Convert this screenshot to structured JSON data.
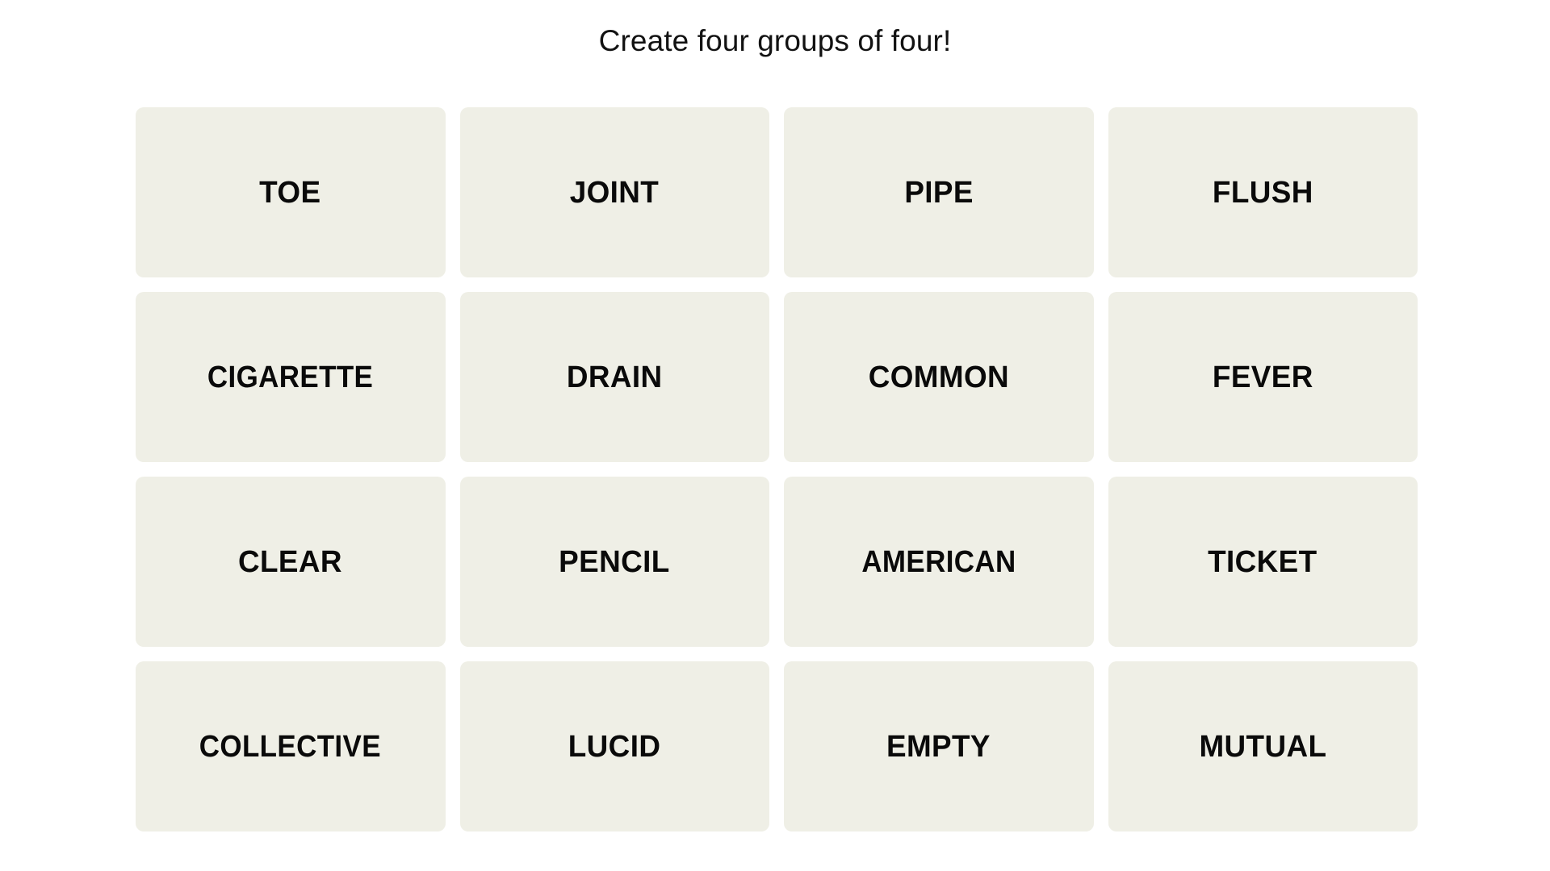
{
  "page": {
    "background_color": "#ffffff",
    "title": "Create four groups of four!"
  },
  "board": {
    "tile_color": "#efefe6",
    "text_color": "#0a0a0a",
    "rows": 4,
    "columns": 4,
    "tiles": [
      {
        "label": "TOE"
      },
      {
        "label": "JOINT"
      },
      {
        "label": "PIPE"
      },
      {
        "label": "FLUSH"
      },
      {
        "label": "CIGARETTE"
      },
      {
        "label": "DRAIN"
      },
      {
        "label": "COMMON"
      },
      {
        "label": "FEVER"
      },
      {
        "label": "CLEAR"
      },
      {
        "label": "PENCIL"
      },
      {
        "label": "AMERICAN"
      },
      {
        "label": "TICKET"
      },
      {
        "label": "COLLECTIVE"
      },
      {
        "label": "LUCID"
      },
      {
        "label": "EMPTY"
      },
      {
        "label": "MUTUAL"
      }
    ]
  }
}
